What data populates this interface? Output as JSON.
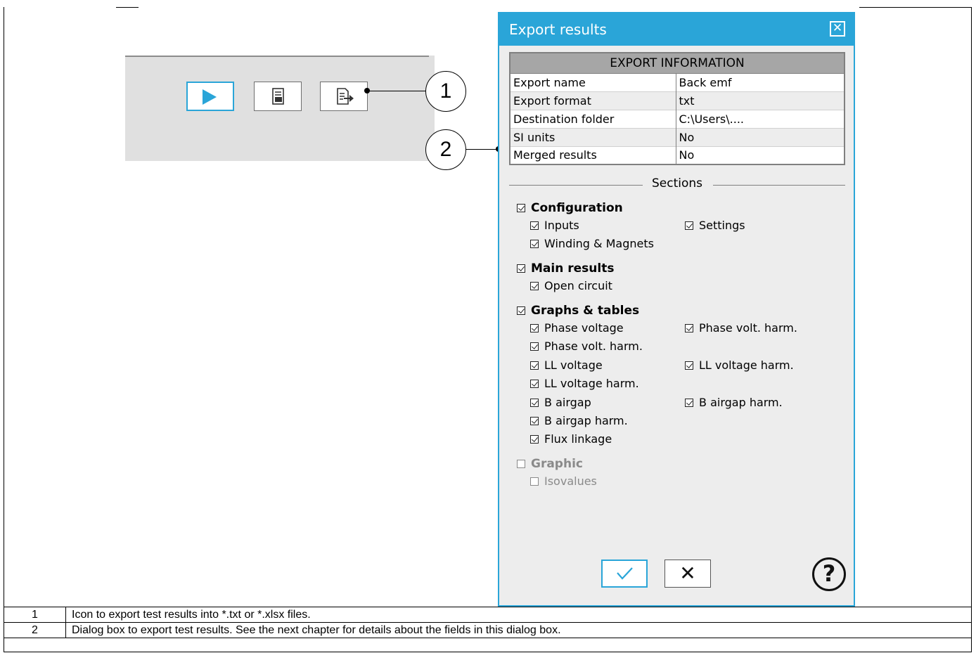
{
  "toolbar": {
    "buttons": [
      {
        "name": "run",
        "icon": "play-icon"
      },
      {
        "name": "report",
        "icon": "report-document-icon"
      },
      {
        "name": "export",
        "icon": "export-document-icon"
      }
    ]
  },
  "callouts": {
    "one": "1",
    "two": "2"
  },
  "dialog": {
    "title": "Export results",
    "close_icon": "close-box-icon",
    "info_header": "EXPORT INFORMATION",
    "info_rows": [
      {
        "label": "Export name",
        "value": "Back emf"
      },
      {
        "label": "Export format",
        "value": "txt"
      },
      {
        "label": "Destination folder",
        "value": "C:\\Users\\...."
      },
      {
        "label": "SI units",
        "value": "No"
      },
      {
        "label": "Merged results",
        "value": "No"
      }
    ],
    "sections_label": "Sections",
    "groups": {
      "configuration": {
        "label": "Configuration",
        "checked": true,
        "items": [
          {
            "label": "Inputs",
            "checked": true
          },
          {
            "label": "Settings",
            "checked": true
          },
          {
            "label": "Winding & Magnets",
            "checked": true
          }
        ]
      },
      "main_results": {
        "label": "Main results",
        "checked": true,
        "items": [
          {
            "label": "Open circuit",
            "checked": true
          }
        ]
      },
      "graphs_tables": {
        "label": "Graphs & tables",
        "checked": true,
        "items": [
          {
            "label": "Phase voltage",
            "checked": true
          },
          {
            "label": "Phase volt. harm.",
            "checked": true
          },
          {
            "label": "Phase volt. harm.",
            "checked": true
          },
          {
            "label": "LL voltage",
            "checked": true
          },
          {
            "label": "LL voltage harm.",
            "checked": true
          },
          {
            "label": "LL voltage harm.",
            "checked": true
          },
          {
            "label": "B airgap",
            "checked": true
          },
          {
            "label": "B airgap harm.",
            "checked": true
          },
          {
            "label": "B airgap harm.",
            "checked": true
          },
          {
            "label": "Flux linkage",
            "checked": true
          }
        ]
      },
      "graphic": {
        "label": "Graphic",
        "checked": false,
        "disabled": true,
        "items": [
          {
            "label": "Isovalues",
            "checked": false
          }
        ]
      }
    },
    "ok_icon": "checkmark-icon",
    "cancel_label": "✕",
    "help_label": "?"
  },
  "legend": [
    {
      "num": "1",
      "text": "Icon to export test results into *.txt or *.xlsx files."
    },
    {
      "num": "2",
      "text": "Dialog box to export test results. See the next chapter for details about the fields in this dialog box."
    }
  ],
  "colors": {
    "accent": "#2aa5d8",
    "dialog_bg": "#ededed",
    "header_gray": "#a6a6a6",
    "panel_gray": "#e0e0e0"
  }
}
